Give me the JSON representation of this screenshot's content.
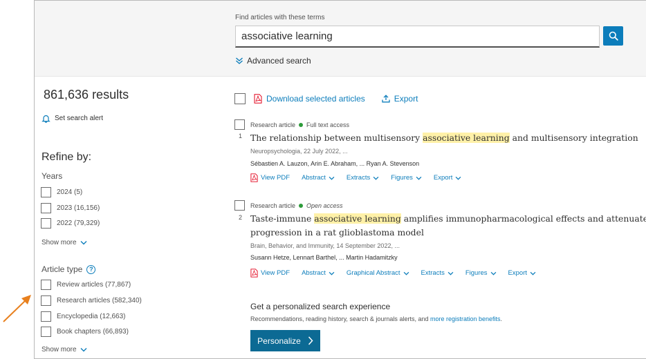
{
  "search": {
    "label": "Find articles with these terms",
    "query": "associative learning",
    "advanced_label": "Advanced search"
  },
  "sidebar": {
    "results_count": "861,636 results",
    "set_alert_label": "Set search alert",
    "refine_title": "Refine by:",
    "years": {
      "title": "Years",
      "options": [
        "2024 (5)",
        "2023 (16,156)",
        "2022 (79,329)"
      ],
      "show_more": "Show more"
    },
    "article_type": {
      "title": "Article type",
      "help_glyph": "?",
      "options": [
        "Review articles (77,867)",
        "Research articles (582,340)",
        "Encyclopedia (12,663)",
        "Book chapters (66,893)"
      ],
      "show_more": "Show more"
    }
  },
  "toolbar": {
    "download_label": "Download selected articles",
    "export_label": "Export"
  },
  "results": [
    {
      "number": "1",
      "type": "Research article",
      "access": "Full text access",
      "title_pre": "The relationship between multisensory ",
      "title_hl": "associative learning",
      "title_post": " and multisensory integration",
      "title_line2": "",
      "meta": "Neuropsychologia, 22 July 2022, ...",
      "authors": "Sébastien A. Lauzon, Arin E. Abraham, ... Ryan A. Stevenson",
      "actions": [
        "View PDF",
        "Abstract",
        "Extracts",
        "Figures",
        "Export"
      ]
    },
    {
      "number": "2",
      "type": "Research article",
      "access": "Open access",
      "title_pre": "Taste-immune ",
      "title_hl": "associative learning",
      "title_post": " amplifies immunopharmacological effects and attenuates disease",
      "title_line2": "progression in a rat glioblastoma model",
      "meta": "Brain, Behavior, and Immunity, 14 September 2022, ...",
      "authors": "Susann Hetze, Lennart Barthel, ... Martin Hadamitzky",
      "actions": [
        "View PDF",
        "Abstract",
        "Graphical Abstract",
        "Extracts",
        "Figures",
        "Export"
      ]
    }
  ],
  "personalize": {
    "title": "Get a personalized search experience",
    "subtitle_prefix": "Recommendations, reading history, search & journals alerts, and ",
    "subtitle_link": "more registration benefits",
    "subtitle_suffix": ".",
    "button_label": "Personalize"
  },
  "colors": {
    "accent": "#0c7dbb",
    "button_dark": "#0c6a94",
    "highlight": "#fff1a8",
    "access_green": "#2d9b3a",
    "pdf_red": "#e2001a",
    "annotation_arrow": "#e8801e"
  },
  "icons": {
    "search": "magnifier-icon",
    "advanced": "double-chevron-down-icon",
    "alert": "bell-icon",
    "pdf": "pdf-file-icon",
    "export": "upload-arrow-icon",
    "dropdown": "chevron-down-icon",
    "personalize": "chevron-right-icon"
  }
}
